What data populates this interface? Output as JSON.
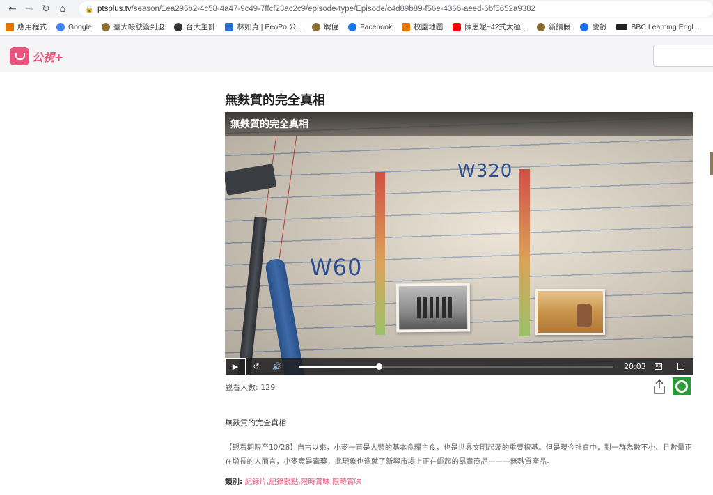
{
  "browser": {
    "url_host": "ptsplus.tv",
    "url_path": "/season/1ea295b2-4c58-4a47-9c49-7ffcf23ac2c9/episode-type/Episode/c4d89b89-f56e-4366-aeed-6bf5652a9382",
    "bookmarks": [
      {
        "label": "應用程式",
        "color": "#e37400"
      },
      {
        "label": "Google",
        "color": "#4285f4"
      },
      {
        "label": "臺大帳號簽到退",
        "color": "#8d6e35"
      },
      {
        "label": "台大主計",
        "color": "#333333"
      },
      {
        "label": "林如貞 | PeoPo 公...",
        "color": "#2a6fcf"
      },
      {
        "label": "聘僱",
        "color": "#8d6e35"
      },
      {
        "label": "Facebook",
        "color": "#1877f2"
      },
      {
        "label": "校園地圖",
        "color": "#e37400"
      },
      {
        "label": "陳思妮~42式太極...",
        "color": "#ff0000"
      },
      {
        "label": "新請假",
        "color": "#8d6e35"
      },
      {
        "label": "慶齡",
        "color": "#1a73e8"
      },
      {
        "label": "BBC Learning Engl...",
        "color": "#222222"
      }
    ]
  },
  "site": {
    "logo_text": "公視+"
  },
  "episode": {
    "title": "無麩質的完全真相",
    "video_overlay_title": "無麩質的完全真相",
    "video_labels": {
      "w60": "W60",
      "w320": "W320"
    },
    "duration": "20:03",
    "progress": 0.255,
    "views": "觀看人數: 129",
    "desc_title": "無麩質的完全真相",
    "description": "【觀看期限至10/28】自古以來，小麥一直是人類的基本食糧主食，也是世界文明起源的重要根基。但是現今社會中，對一群為數不小、且數量正在增長的人而言，小麥竟是毒藥，此現象也造就了新興市場上正在崛起的昂貴商品———無麩質產品。",
    "category_label": "類別:",
    "categories": "紀錄片,紀錄觀點,限時賞味,限時賞味"
  },
  "colors": {
    "accent": "#e8547b",
    "green_badge": "#2e9b3a"
  }
}
